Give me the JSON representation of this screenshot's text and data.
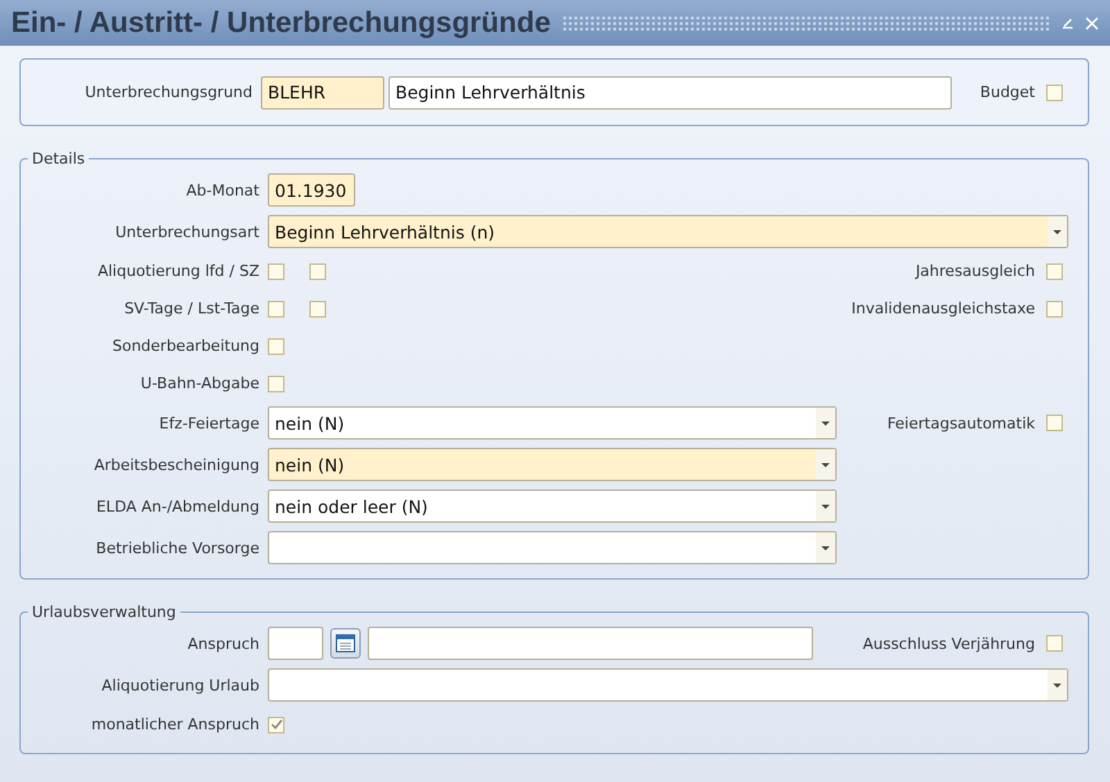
{
  "window": {
    "title": "Ein- / Austritt- / Unterbrechungsgründe"
  },
  "header": {
    "label": "Unterbrechungsgrund",
    "code": "BLEHR",
    "code_required": true,
    "description": "Beginn Lehrverhältnis",
    "description_required": false,
    "budget": {
      "label": "Budget",
      "checked": false
    }
  },
  "sections": [
    {
      "legend": "Details",
      "rows": [
        {
          "kind": "text",
          "label": "Ab-Monat",
          "value": "01.1930",
          "required": true
        },
        {
          "kind": "select-wide",
          "label": "Unterbrechungsart",
          "value": "Beginn Lehrverhältnis (n)",
          "required": true
        },
        {
          "kind": "checks",
          "label": "Aliquotierung lfd / SZ",
          "checks": [
            {
              "checked": false
            },
            {
              "checked": false
            }
          ],
          "side": {
            "label": "Jahresausgleich",
            "checked": false
          }
        },
        {
          "kind": "checks",
          "label": "SV-Tage / Lst-Tage",
          "checks": [
            {
              "checked": false
            },
            {
              "checked": false
            }
          ],
          "side": {
            "label": "Invalidenausgleichstaxe",
            "checked": false
          }
        },
        {
          "kind": "checks",
          "label": "Sonderbearbeitung",
          "checks": [
            {
              "checked": false
            }
          ]
        },
        {
          "kind": "checks",
          "label": "U-Bahn-Abgabe",
          "checks": [
            {
              "checked": false
            }
          ]
        },
        {
          "kind": "select",
          "label": "Efz-Feiertage",
          "value": "nein (N)",
          "required": false,
          "side": {
            "label": "Feiertagsautomatik",
            "checked": false
          }
        },
        {
          "kind": "select",
          "label": "Arbeitsbescheinigung",
          "value": "nein (N)",
          "required": true
        },
        {
          "kind": "select",
          "label": "ELDA An-/Abmeldung",
          "value": "nein oder leer (N)",
          "required": false
        },
        {
          "kind": "select",
          "label": "Betriebliche Vorsorge",
          "required": false
        }
      ]
    },
    {
      "legend": "Urlaubsverwaltung",
      "rows": [
        {
          "kind": "amount",
          "label": "Anspruch",
          "side": {
            "label": "Ausschluss Verjährung",
            "checked": false
          }
        },
        {
          "kind": "select-wide",
          "label": "Aliquotierung Urlaub",
          "required": false
        },
        {
          "kind": "checks",
          "label": "monatlicher Anspruch",
          "checks": [
            {
              "checked": true
            }
          ]
        }
      ]
    }
  ]
}
